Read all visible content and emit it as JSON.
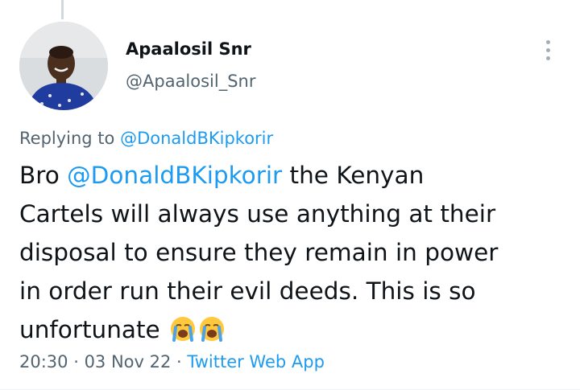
{
  "author": {
    "name": "Apaalosil Snr",
    "handle": "@Apaalosil_Snr",
    "avatar_icon": "profile-photo-icon"
  },
  "menu_icon": "more-options-icon",
  "reply": {
    "prefix": "Replying to ",
    "mention": "@DonaldBKipkorir"
  },
  "tweet": {
    "line1_pre": "Bro ",
    "line1_mention": "@DonaldBKipkorir",
    "line1_post": " the Kenyan",
    "line2": "Cartels will always use anything at their",
    "line3": "disposal to ensure they remain in power",
    "line4": "in order run their evil deeds. This is so",
    "line5": "unfortunate",
    "emoji_icon": "loudly-crying-face-icon"
  },
  "meta": {
    "time": "20:30",
    "sep1": " · ",
    "date": "03 Nov 22",
    "sep2": " · ",
    "source": "Twitter Web App"
  },
  "colors": {
    "text": "#0f1419",
    "secondary": "#536471",
    "link": "#1d9bf0"
  }
}
